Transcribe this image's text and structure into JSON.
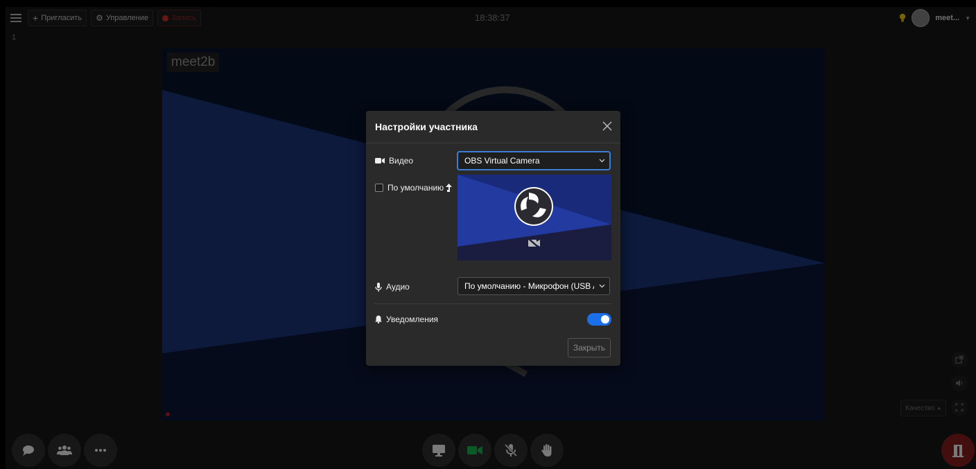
{
  "topbar": {
    "invite_label": "Пригласить",
    "manage_label": "Управление",
    "record_label": "Запись",
    "clock": "18:38:37",
    "user_name": "meet...",
    "icons": {
      "menu": "hamburger-icon",
      "invite": "plus-icon",
      "manage": "gear-icon",
      "record": "record-dot-icon",
      "hint": "lightbulb-icon",
      "avatar": "avatar-icon",
      "dropdown": "caret-down-icon"
    }
  },
  "stage": {
    "tile_number": "1",
    "participant_name": "meet2b"
  },
  "modal": {
    "title": "Настройки участника",
    "video_label": "Видео",
    "video_device": "OBS Virtual Camera",
    "default_label": "По умолчанию",
    "audio_label": "Аудио",
    "audio_device": "По умолчанию - Микрофон (USB Audio Device)",
    "notifications_label": "Уведомления",
    "notifications_enabled": true,
    "default_checked": false,
    "close_button": "Закрыть",
    "icons": {
      "video": "video-camera-icon",
      "audio": "microphone-icon",
      "notifications": "bell-icon",
      "default": "arrow-up-icon",
      "close": "close-icon",
      "select": "chevron-down-icon",
      "preview_logo": "obs-logo-icon",
      "camera_off": "camera-off-icon"
    }
  },
  "side_controls": {
    "quality_label": "Качество",
    "icons": {
      "popout": "external-link-icon",
      "volume": "volume-icon",
      "fullscreen": "fullscreen-icon",
      "quality": "caret-up-icon"
    }
  },
  "bottom_controls": {
    "icons": {
      "chat": "chat-icon",
      "participants": "participants-icon",
      "more": "more-icon",
      "screen_share": "monitor-icon",
      "camera": "video-camera-icon",
      "mic": "microphone-muted-icon",
      "raise_hand": "hand-icon",
      "leave": "door-exit-icon"
    }
  },
  "colors": {
    "accent": "#1c6fe8",
    "record": "#c0282a",
    "leave": "#7a1a1a",
    "video_bg": "#071227",
    "video_band": "#18306e"
  }
}
